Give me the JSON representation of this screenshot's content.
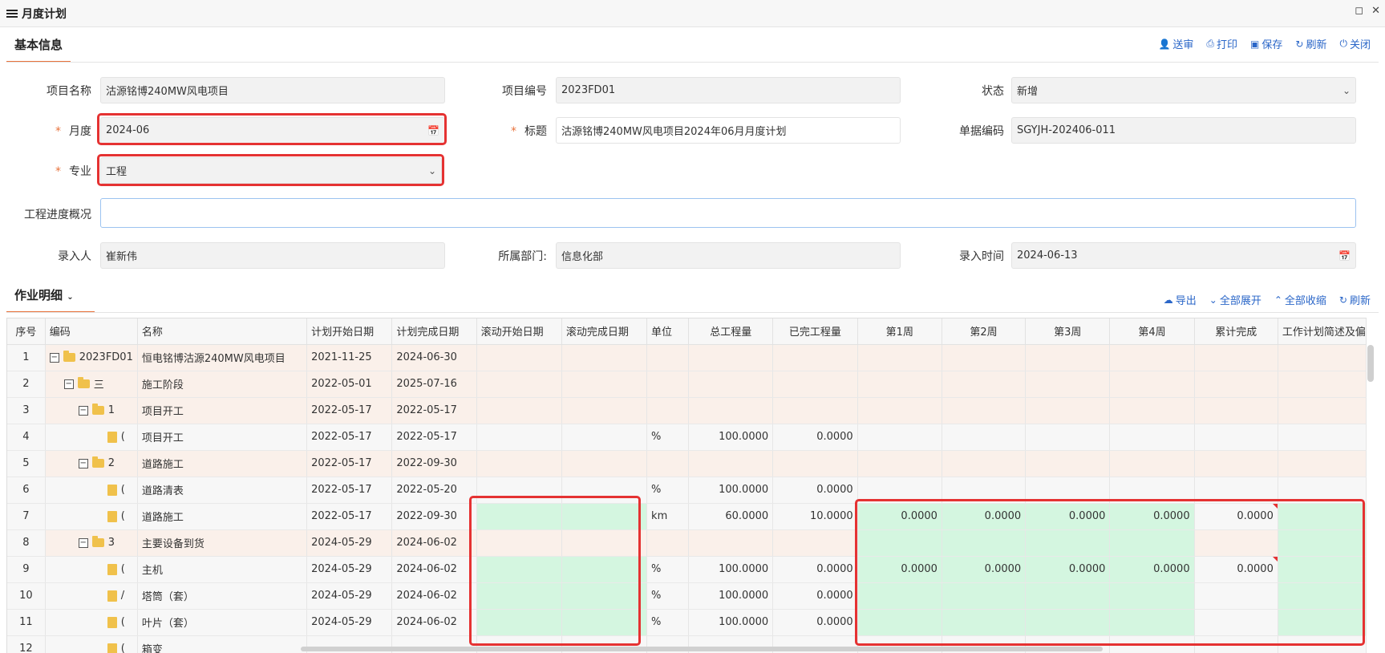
{
  "window": {
    "title": "月度计划",
    "menu_icon": "hamburger-icon",
    "maximize_icon": "maximize-icon",
    "close_icon": "close-icon"
  },
  "basic": {
    "tab": "基本信息",
    "toolbar": [
      {
        "label": "送审",
        "icon": "user-send-icon"
      },
      {
        "label": "打印",
        "icon": "print-icon"
      },
      {
        "label": "保存",
        "icon": "save-icon"
      },
      {
        "label": "刷新",
        "icon": "refresh-icon"
      },
      {
        "label": "关闭",
        "icon": "power-icon"
      }
    ]
  },
  "form": {
    "project_name_label": "项目名称",
    "project_name": "沽源铭博240MW风电项目",
    "project_code_label": "项目编号",
    "project_code": "2023FD01",
    "status_label": "状态",
    "status": "新增",
    "month_label": "月度",
    "month": "2024-06",
    "title_label": "标题",
    "title": "沽源铭博240MW风电项目2024年06月月度计划",
    "doc_code_label": "单据编码",
    "doc_code": "SGYJH-202406-011",
    "major_label": "专业",
    "major": "工程",
    "progress_label": "工程进度概况",
    "progress": "",
    "entered_by_label": "录入人",
    "entered_by": "崔新伟",
    "dept_label": "所属部门:",
    "dept": "信息化部",
    "entry_time_label": "录入时间",
    "entry_time": "2024-06-13",
    "required_mark": "*"
  },
  "detail": {
    "tab": "作业明细",
    "toolbar": [
      {
        "label": "导出",
        "icon": "cloud-download-icon"
      },
      {
        "label": "全部展开",
        "icon": "expand-icon"
      },
      {
        "label": "全部收缩",
        "icon": "collapse-icon"
      },
      {
        "label": "刷新",
        "icon": "refresh-icon"
      }
    ]
  },
  "grid": {
    "columns": [
      "序号",
      "编码",
      "名称",
      "计划开始日期",
      "计划完成日期",
      "滚动开始日期",
      "滚动完成日期",
      "单位",
      "总工程量",
      "已完工程量",
      "第1周",
      "第2周",
      "第3周",
      "第4周",
      "累计完成",
      "工作计划简述及偏"
    ],
    "rows": [
      {
        "seq": "1",
        "code": "2023FD01",
        "name": "恒电铭博沽源240MW风电项目",
        "ps": "2021-11-25",
        "pe": "2024-06-30",
        "unit": "",
        "total": "",
        "done": "",
        "w1": "",
        "w2": "",
        "w3": "",
        "w4": "",
        "cum": ""
      },
      {
        "seq": "2",
        "code": "三",
        "name": "施工阶段",
        "ps": "2022-05-01",
        "pe": "2025-07-16",
        "unit": "",
        "total": "",
        "done": "",
        "w1": "",
        "w2": "",
        "w3": "",
        "w4": "",
        "cum": ""
      },
      {
        "seq": "3",
        "code": "1",
        "name": "项目开工",
        "ps": "2022-05-17",
        "pe": "2022-05-17",
        "unit": "",
        "total": "",
        "done": "",
        "w1": "",
        "w2": "",
        "w3": "",
        "w4": "",
        "cum": ""
      },
      {
        "seq": "4",
        "code": "(",
        "name": "项目开工",
        "ps": "2022-05-17",
        "pe": "2022-05-17",
        "unit": "%",
        "total": "100.0000",
        "done": "0.0000",
        "w1": "",
        "w2": "",
        "w3": "",
        "w4": "",
        "cum": ""
      },
      {
        "seq": "5",
        "code": "2",
        "name": "道路施工",
        "ps": "2022-05-17",
        "pe": "2022-09-30",
        "unit": "",
        "total": "",
        "done": "",
        "w1": "",
        "w2": "",
        "w3": "",
        "w4": "",
        "cum": ""
      },
      {
        "seq": "6",
        "code": "(",
        "name": "道路清表",
        "ps": "2022-05-17",
        "pe": "2022-05-20",
        "unit": "%",
        "total": "100.0000",
        "done": "0.0000",
        "w1": "",
        "w2": "",
        "w3": "",
        "w4": "",
        "cum": ""
      },
      {
        "seq": "7",
        "code": "(",
        "name": "道路施工",
        "ps": "2022-05-17",
        "pe": "2022-09-30",
        "unit": "km",
        "total": "60.0000",
        "done": "10.0000",
        "w1": "0.0000",
        "w2": "0.0000",
        "w3": "0.0000",
        "w4": "0.0000",
        "cum": "0.0000"
      },
      {
        "seq": "8",
        "code": "3",
        "name": "主要设备到货",
        "ps": "2024-05-29",
        "pe": "2024-06-02",
        "unit": "",
        "total": "",
        "done": "",
        "w1": "",
        "w2": "",
        "w3": "",
        "w4": "",
        "cum": ""
      },
      {
        "seq": "9",
        "code": "(",
        "name": "主机",
        "ps": "2024-05-29",
        "pe": "2024-06-02",
        "unit": "%",
        "total": "100.0000",
        "done": "0.0000",
        "w1": "0.0000",
        "w2": "0.0000",
        "w3": "0.0000",
        "w4": "0.0000",
        "cum": "0.0000"
      },
      {
        "seq": "10",
        "code": "/",
        "name": "塔筒（套）",
        "ps": "2024-05-29",
        "pe": "2024-06-02",
        "unit": "%",
        "total": "100.0000",
        "done": "0.0000",
        "w1": "",
        "w2": "",
        "w3": "",
        "w4": "",
        "cum": ""
      },
      {
        "seq": "11",
        "code": "(",
        "name": "叶片（套）",
        "ps": "2024-05-29",
        "pe": "2024-06-02",
        "unit": "%",
        "total": "100.0000",
        "done": "0.0000",
        "w1": "",
        "w2": "",
        "w3": "",
        "w4": "",
        "cum": ""
      },
      {
        "seq": "12",
        "code": "(",
        "name": "箱变",
        "ps": "",
        "pe": "",
        "unit": "",
        "total": "",
        "done": "",
        "w1": "",
        "w2": "",
        "w3": "",
        "w4": "",
        "cum": ""
      }
    ]
  },
  "colors": {
    "accent": "#e8733c",
    "link": "#2a66c8",
    "highlight": "#e53232",
    "editable_cell": "#d4f6e0",
    "parent_row": "#faf0ea"
  }
}
